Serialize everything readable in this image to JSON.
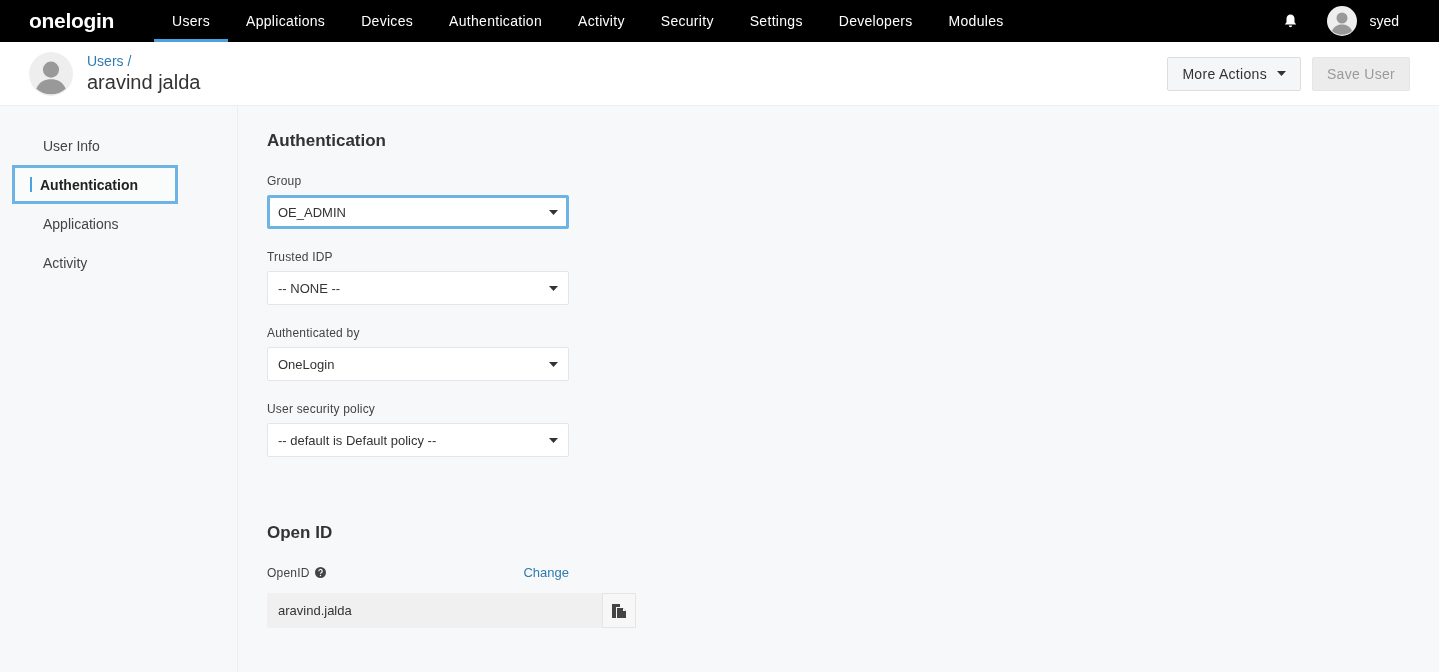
{
  "logo": "onelogin",
  "nav": [
    {
      "label": "Users",
      "selected": true
    },
    {
      "label": "Applications",
      "selected": false
    },
    {
      "label": "Devices",
      "selected": false
    },
    {
      "label": "Authentication",
      "selected": false
    },
    {
      "label": "Activity",
      "selected": false
    },
    {
      "label": "Security",
      "selected": false
    },
    {
      "label": "Settings",
      "selected": false
    },
    {
      "label": "Developers",
      "selected": false
    },
    {
      "label": "Modules",
      "selected": false
    }
  ],
  "account": {
    "name": "syed"
  },
  "header": {
    "breadcrumb": "Users /",
    "title": "aravind jalda",
    "buttons": [
      {
        "label": "More Actions",
        "kind": "dropdown",
        "disabled": false
      },
      {
        "label": "Save User",
        "kind": "primary",
        "disabled": true
      }
    ]
  },
  "sidebar": {
    "items": [
      {
        "label": "User Info",
        "selected": false
      },
      {
        "label": "Authentication",
        "selected": true
      },
      {
        "label": "Applications",
        "selected": false
      },
      {
        "label": "Activity",
        "selected": false
      }
    ]
  },
  "authentication": {
    "heading": "Authentication",
    "fields": [
      {
        "label": "Group",
        "value": "OE_ADMIN",
        "focused": true
      },
      {
        "label": "Trusted IDP",
        "value": "-- NONE --",
        "focused": false
      },
      {
        "label": "Authenticated by",
        "value": "OneLogin",
        "focused": false
      },
      {
        "label": "User security policy",
        "value": "-- default is Default policy --",
        "focused": false
      }
    ]
  },
  "open_id": {
    "heading": "Open ID",
    "label": "OpenID",
    "link": "Change",
    "value": "aravind.jalda"
  }
}
